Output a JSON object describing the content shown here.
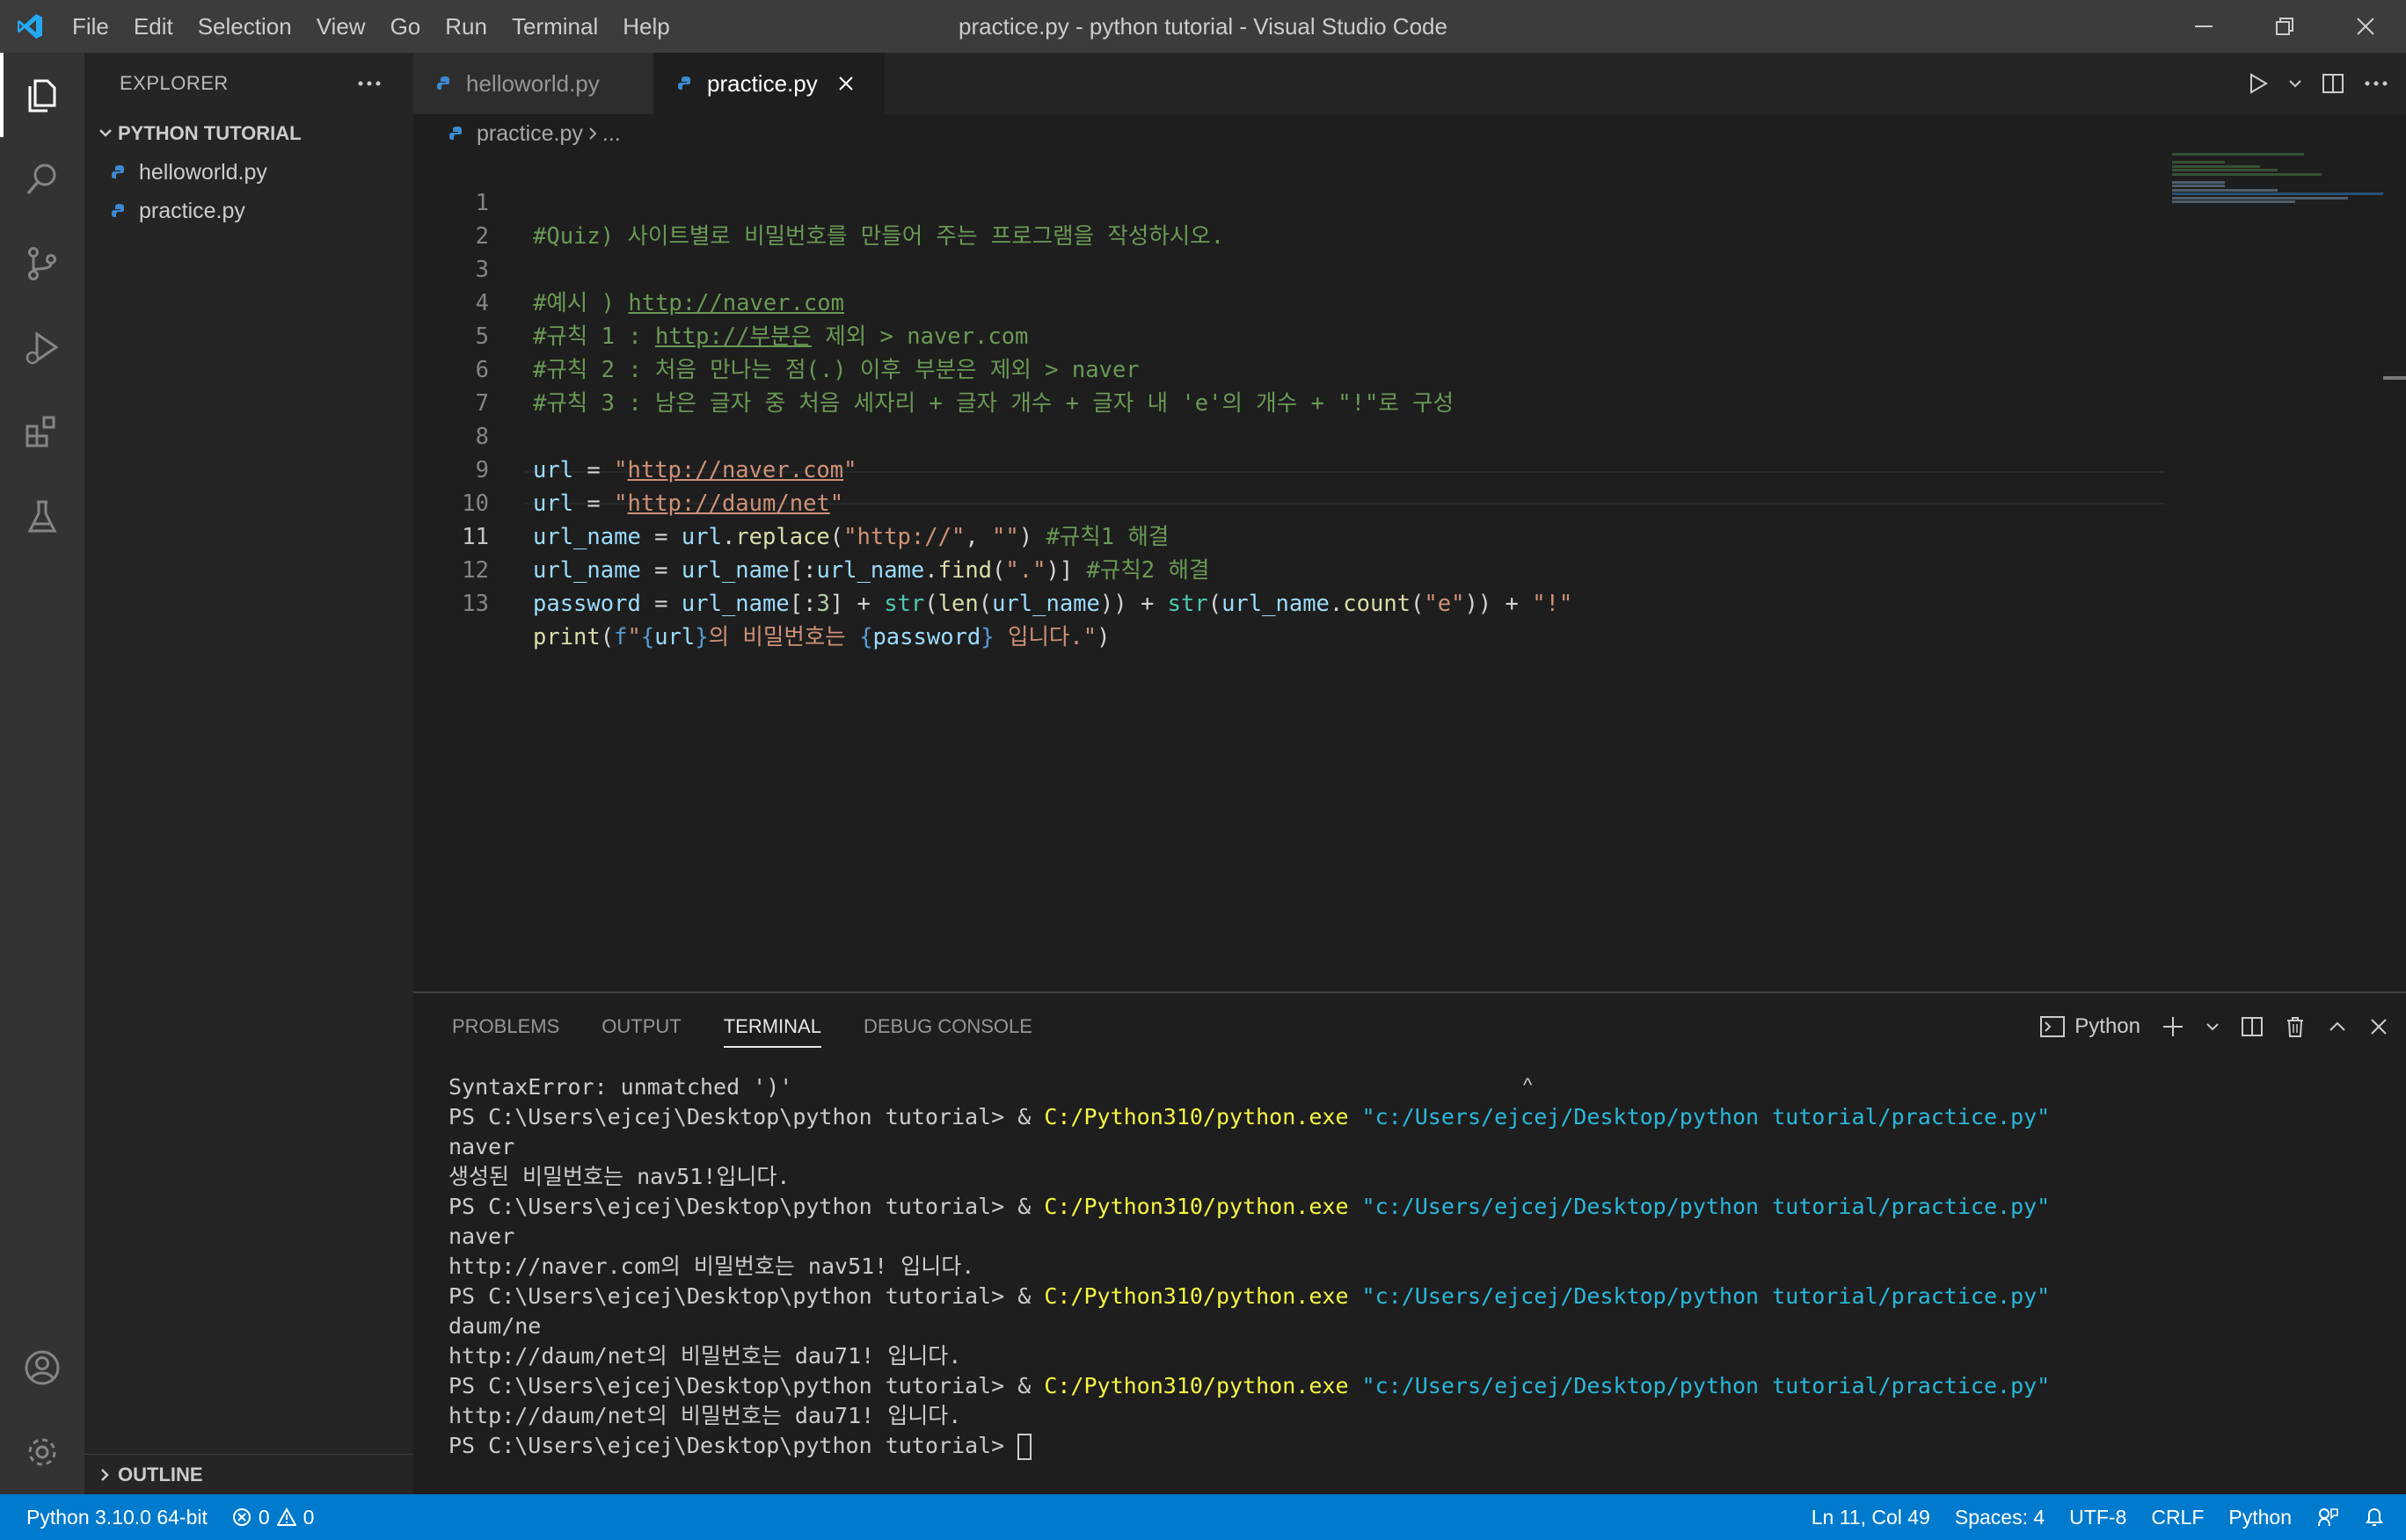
{
  "window": {
    "title": "practice.py - python tutorial - Visual Studio Code"
  },
  "menu": [
    "File",
    "Edit",
    "Selection",
    "View",
    "Go",
    "Run",
    "Terminal",
    "Help"
  ],
  "sidebar": {
    "title": "EXPLORER",
    "folder": "PYTHON TUTORIAL",
    "files": [
      "helloworld.py",
      "practice.py"
    ],
    "outline": "OUTLINE"
  },
  "tabs": [
    {
      "label": "helloworld.py",
      "active": false
    },
    {
      "label": "practice.py",
      "active": true
    }
  ],
  "breadcrumb": {
    "file": "practice.py",
    "rest": "..."
  },
  "editor": {
    "line_numbers": [
      "1",
      "2",
      "3",
      "4",
      "5",
      "6",
      "7",
      "8",
      "9",
      "10",
      "11",
      "12",
      "13"
    ],
    "current_line": "11",
    "lines": {
      "l1": "#Quiz) 사이트별로 비밀번호를 만들어 주는 프로그램을 작성하시오.",
      "l3a": "#예시 ) ",
      "l3b": "http://naver.com",
      "l4a": "#규칙 1 : ",
      "l4b": "http://부분은",
      "l4c": " 제외 > naver.com",
      "l5": "#규칙 2 : 처음 만나는 점(.) 이후 부분은 제외 > naver",
      "l6": "#규칙 3 : 남은 글자 중 처음 세자리 + 글자 개수 + 글자 내 'e'의 개수 + \"!\"로 구성",
      "l8_var": "url",
      "l8_op": " = ",
      "l8_q1": "\"",
      "l8_url": "http://naver.com",
      "l8_q2": "\"",
      "l9_var": "url",
      "l9_op": " = ",
      "l9_q1": "\"",
      "l9_url": "http://daum/net",
      "l9_q2": "\"",
      "l10_a": "url_name",
      "l10_b": " = ",
      "l10_c": "url",
      "l10_d": ".",
      "l10_e": "replace",
      "l10_f": "(",
      "l10_g": "\"http://\"",
      "l10_h": ", ",
      "l10_i": "\"\"",
      "l10_j": ") ",
      "l10_k": "#규칙1 해결",
      "l11_a": "url_name",
      "l11_b": " = ",
      "l11_c": "url_name",
      "l11_d": "[:",
      "l11_e": "url_name",
      "l11_f": ".",
      "l11_g": "find",
      "l11_h": "(",
      "l11_i": "\".\"",
      "l11_j": ")] ",
      "l11_k": "#규칙2 해결",
      "l12_a": "password",
      "l12_b": " = ",
      "l12_c": "url_name",
      "l12_d": "[:",
      "l12_e": "3",
      "l12_f": "] + ",
      "l12_g": "str",
      "l12_h": "(",
      "l12_i": "len",
      "l12_j": "(",
      "l12_k": "url_name",
      "l12_l": ")) + ",
      "l12_m": "str",
      "l12_n": "(",
      "l12_o": "url_name",
      "l12_p": ".",
      "l12_q": "count",
      "l12_r": "(",
      "l12_s": "\"e\"",
      "l12_t": ")) + ",
      "l12_u": "\"!\"",
      "l13_a": "print",
      "l13_b": "(",
      "l13_c": "f",
      "l13_d": "\"",
      "l13_e": "{",
      "l13_f": "url",
      "l13_g": "}",
      "l13_h": "의 비밀번호는 ",
      "l13_i": "{",
      "l13_j": "password",
      "l13_k": "}",
      "l13_l": " 입니다.\"",
      "l13_m": ")"
    }
  },
  "panel": {
    "tabs": [
      "PROBLEMS",
      "OUTPUT",
      "TERMINAL",
      "DEBUG CONSOLE"
    ],
    "active_tab": "TERMINAL",
    "shell": "Python",
    "caret": "^",
    "terminal": {
      "t1": "SyntaxError: unmatched ')'",
      "prompt": "PS C:\\Users\\ejcej\\Desktop\\python tutorial> & ",
      "exe": "C:/Python310/python.exe",
      "script": " \"c:/Users/ejcej/Desktop/python tutorial/practice.py\"",
      "t3": "naver",
      "t4": "생성된 비밀번호는 nav51!입니다.",
      "t6": "naver",
      "t7": "http://naver.com의 비밀번호는 nav51! 입니다.",
      "t9": "daum/ne",
      "t10": "http://daum/net의 비밀번호는 dau71! 입니다.",
      "t12": "http://daum/net의 비밀번호는 dau71! 입니다.",
      "last_prompt": "PS C:\\Users\\ejcej\\Desktop\\python tutorial> "
    }
  },
  "statusbar": {
    "interpreter": "Python 3.10.0 64-bit",
    "errors": "0",
    "warnings": "0",
    "position": "Ln 11, Col 49",
    "spaces": "Spaces: 4",
    "encoding": "UTF-8",
    "eol": "CRLF",
    "language": "Python"
  },
  "colors": {
    "accent": "#007acc",
    "titlebar": "#3c3c3c",
    "editor_bg": "#1e1e1e",
    "sidebar_bg": "#252526"
  }
}
